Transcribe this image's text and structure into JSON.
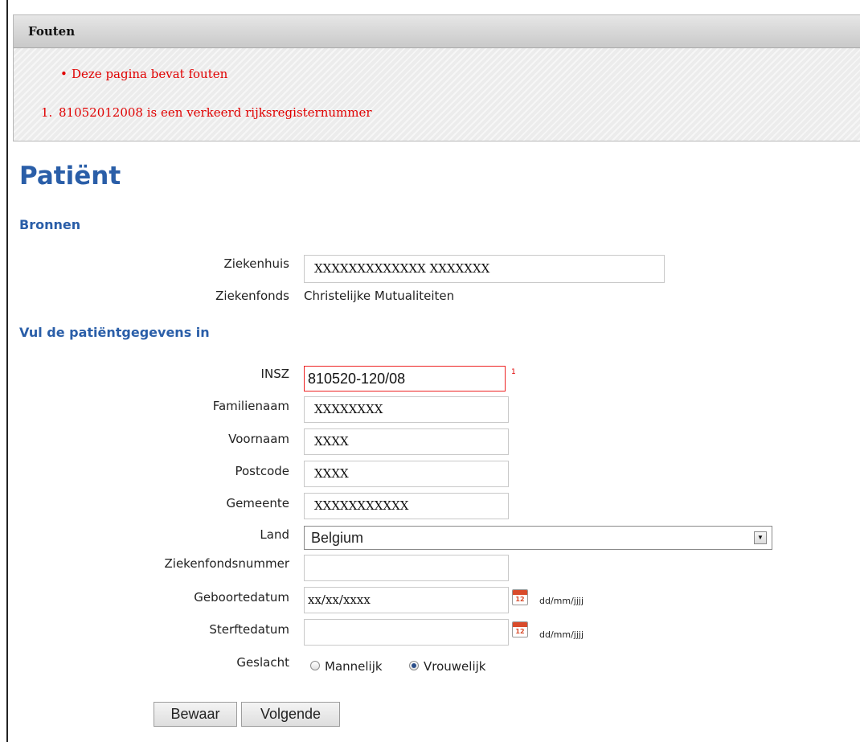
{
  "errors": {
    "header": "Fouten",
    "summary": "Deze pagina bevat fouten",
    "items": [
      {
        "number": "1.",
        "text": "81052012008 is een verkeerd rijksregisternummer"
      }
    ]
  },
  "page": {
    "title": "Patiënt"
  },
  "sources": {
    "heading": "Bronnen",
    "hospital_label": "Ziekenhuis",
    "hospital_value": "XXXXXXXXXXXXX XXXXXXX",
    "fund_label": "Ziekenfonds",
    "fund_value": "Christelijke Mutualiteiten"
  },
  "patient": {
    "heading": "Vul de patiëntgegevens in",
    "insz_label": "INSZ",
    "insz_value": "810520-120/08",
    "insz_error_ref": "1",
    "surname_label": "Familienaam",
    "surname_value": "XXXXXXXX",
    "firstname_label": "Voornaam",
    "firstname_value": "XXXX",
    "postcode_label": "Postcode",
    "postcode_value": "XXXX",
    "city_label": "Gemeente",
    "city_value": "XXXXXXXXXXX",
    "country_label": "Land",
    "country_value": "Belgium",
    "fundnumber_label": "Ziekenfondsnummer",
    "fundnumber_value": "",
    "birthdate_label": "Geboortedatum",
    "birthdate_value": "xx/xx/xxxx",
    "deathdate_label": "Sterftedatum",
    "deathdate_value": "",
    "date_hint": "dd/mm/jjjj",
    "calendar_icon_text": "12",
    "gender_label": "Geslacht",
    "gender_options": [
      {
        "label": "Mannelijk",
        "selected": false
      },
      {
        "label": "Vrouwelijk",
        "selected": true
      }
    ]
  },
  "actions": {
    "save_label": "Bewaar",
    "next_label": "Volgende"
  },
  "colors": {
    "accent": "#2a5ea8",
    "error": "#e00000"
  },
  "icons": {
    "calendar": "calendar-icon",
    "dropdown": "chevron-down-icon",
    "bullet": "bullet-icon"
  }
}
